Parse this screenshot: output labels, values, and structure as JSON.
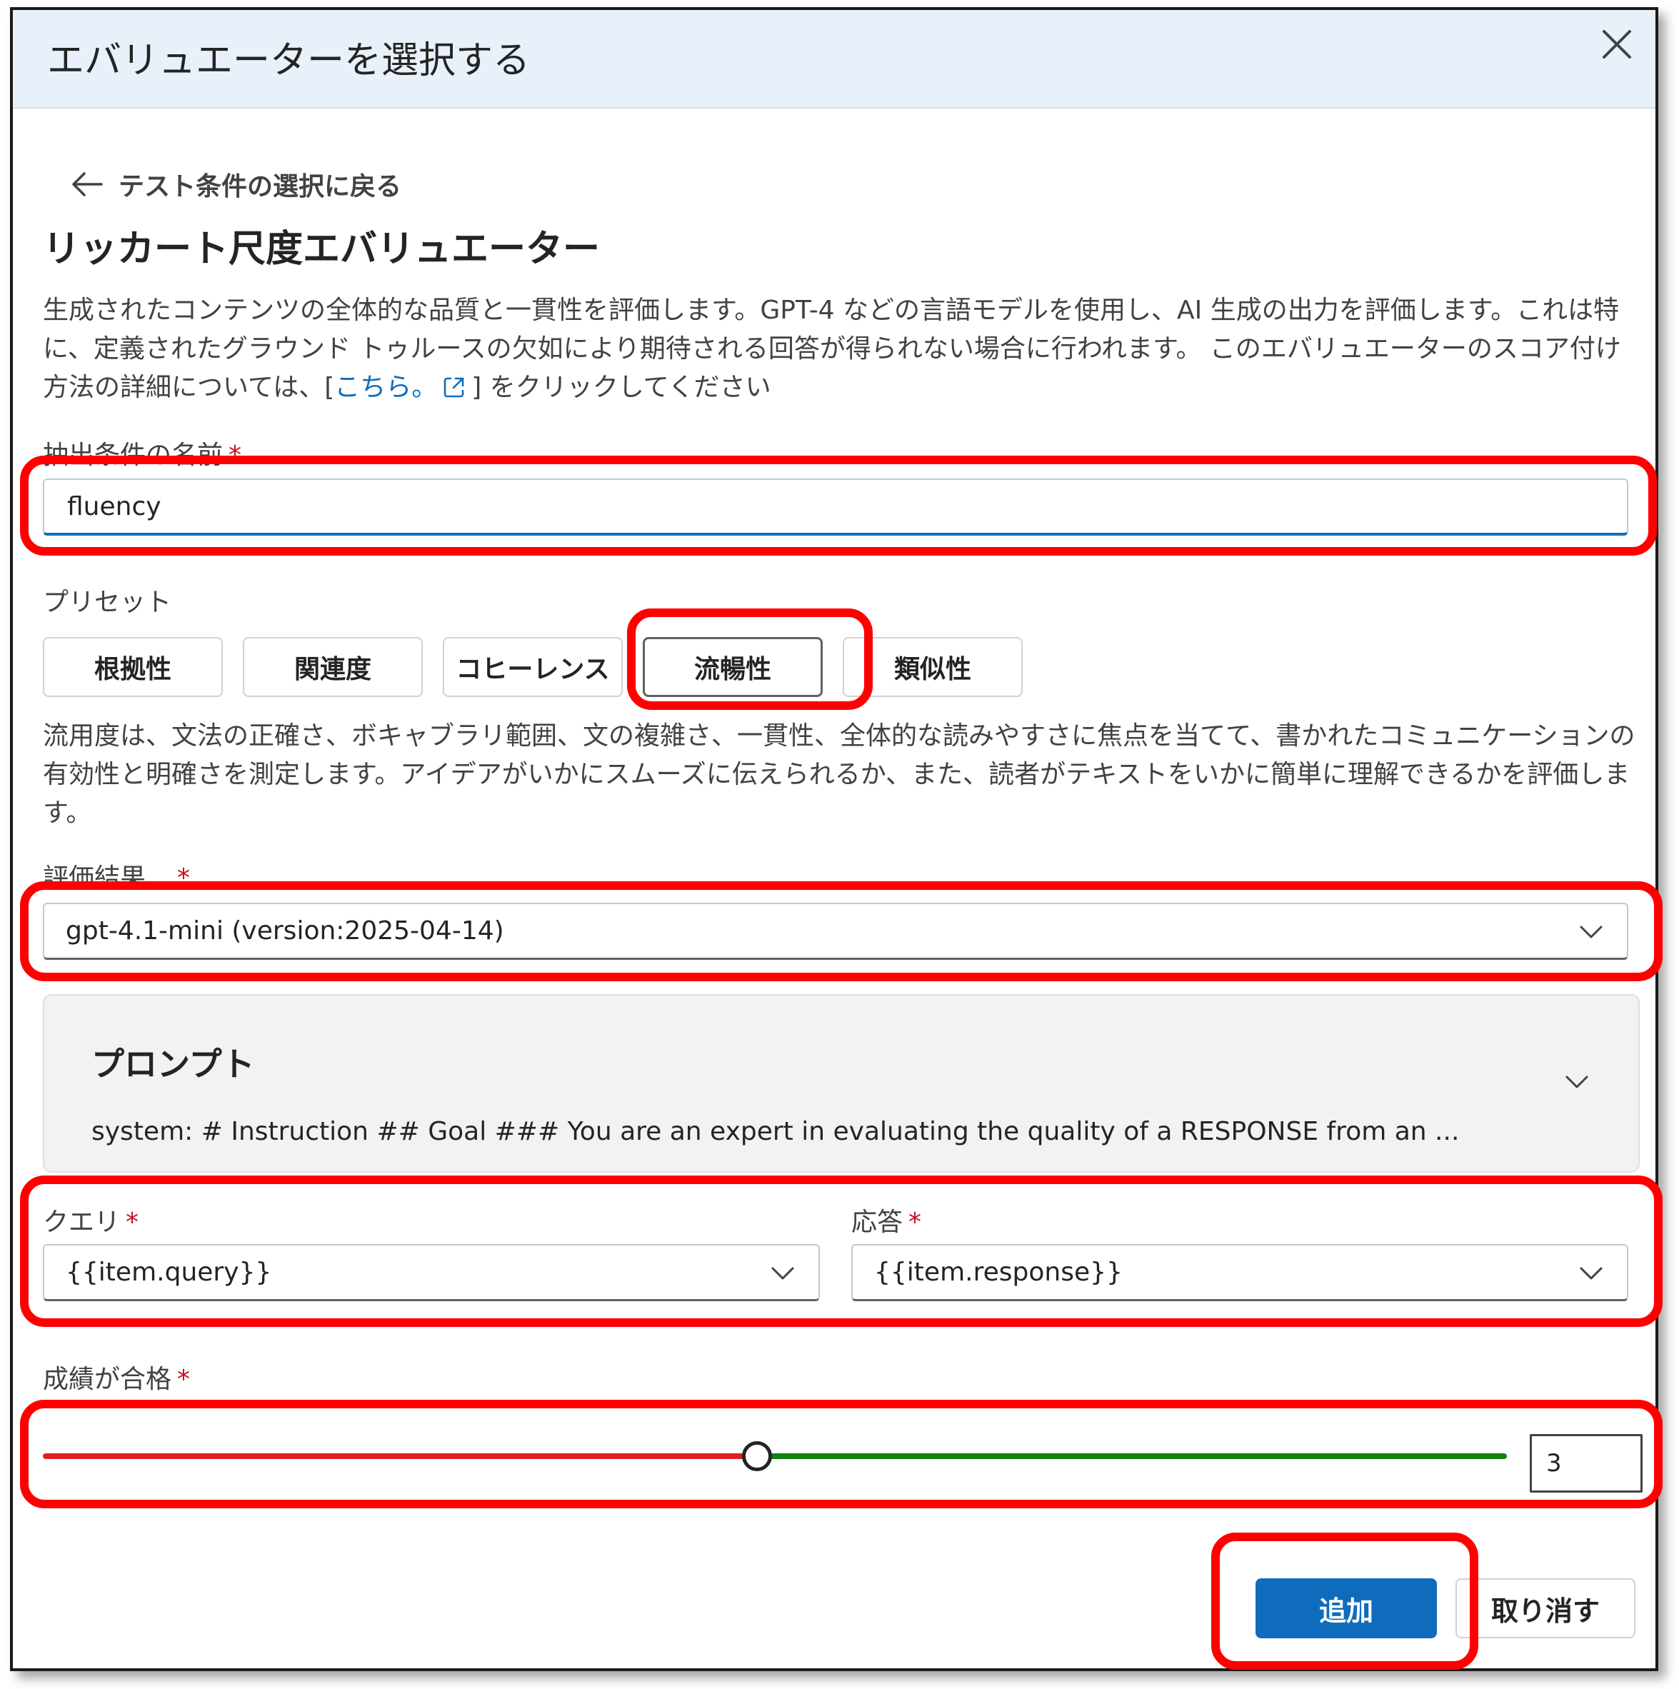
{
  "dialog": {
    "title": "エバリュエーターを選択する",
    "back_label": "テスト条件の選択に戻る",
    "section_title": "リッカート尺度エバリュエーター",
    "description_before_link": "生成されたコンテンツの全体的な品質と一貫性を評価します。GPT-4 などの言語モデルを使用し、AI 生成の出力を評価します。これは特に、定義されたグラウンド トゥルースの欠如により期待される回答が得られない場合に行われます。 このエバリュエーターのスコア付け方法の詳細については、[",
    "description_link": "こちら。",
    "description_after_link": "] をクリックしてください"
  },
  "name_field": {
    "label": "抽出条件の名前",
    "required_mark": "*",
    "value": "fluency"
  },
  "presets": {
    "label": "プリセット",
    "items": [
      {
        "label": "根拠性",
        "active": false
      },
      {
        "label": "関連度",
        "active": false
      },
      {
        "label": "コヒーレンス",
        "active": false
      },
      {
        "label": "流暢性",
        "active": true
      },
      {
        "label": "類似性",
        "active": false
      }
    ],
    "description": "流用度は、文法の正確さ、ボキャブラリ範囲、文の複雑さ、一貫性、全体的な読みやすさに焦点を当てて、書かれたコミュニケーションの有効性と明確さを測定します。アイデアがいかにスムーズに伝えられるか、また、読者がテキストをいかに簡単に理解できるかを評価します。"
  },
  "model_field": {
    "label": "評価結果、",
    "required_mark": "*",
    "value": "gpt-4.1-mini (version:2025-04-14)"
  },
  "prompt": {
    "title": "プロンプト",
    "text": "system: # Instruction ## Goal ### You are an expert in evaluating the quality of a RESPONSE from an ..."
  },
  "query_field": {
    "label": "クエリ",
    "required_mark": "*",
    "value": "{{item.query}}"
  },
  "response_field": {
    "label": "応答",
    "required_mark": "*",
    "value": "{{item.response}}"
  },
  "pass_grade": {
    "label": "成績が合格",
    "required_mark": "*",
    "value": "3",
    "slider_fraction": 0.488
  },
  "actions": {
    "add_label": "追加",
    "cancel_label": "取り消す"
  },
  "colors": {
    "accent": "#0f6cbd",
    "highlight": "#ff0000",
    "slider_low": "#e02020",
    "slider_high": "#118011"
  }
}
